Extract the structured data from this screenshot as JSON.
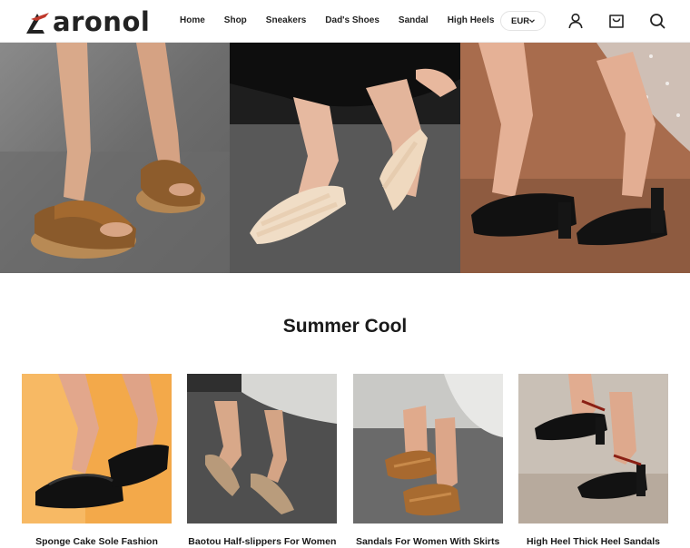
{
  "brand": {
    "name": "aronol"
  },
  "nav": {
    "items": [
      {
        "label": "Home"
      },
      {
        "label": "Shop"
      },
      {
        "label": "Sneakers"
      },
      {
        "label": "Dad's Shoes"
      },
      {
        "label": "Sandal"
      },
      {
        "label": "High Heels"
      }
    ]
  },
  "header": {
    "currency": "EUR",
    "icons": [
      "account-icon",
      "cart-icon",
      "search-icon"
    ]
  },
  "section": {
    "title": "Summer Cool"
  },
  "products": [
    {
      "title": "Sponge Cake Sole Fashion"
    },
    {
      "title": "Baotou Half-slippers For Women"
    },
    {
      "title": "Sandals For Women With Skirts"
    },
    {
      "title": "High Heel Thick Heel Sandals"
    }
  ],
  "colors": {
    "accent": "#c0392b",
    "text": "#1a1a1a"
  }
}
